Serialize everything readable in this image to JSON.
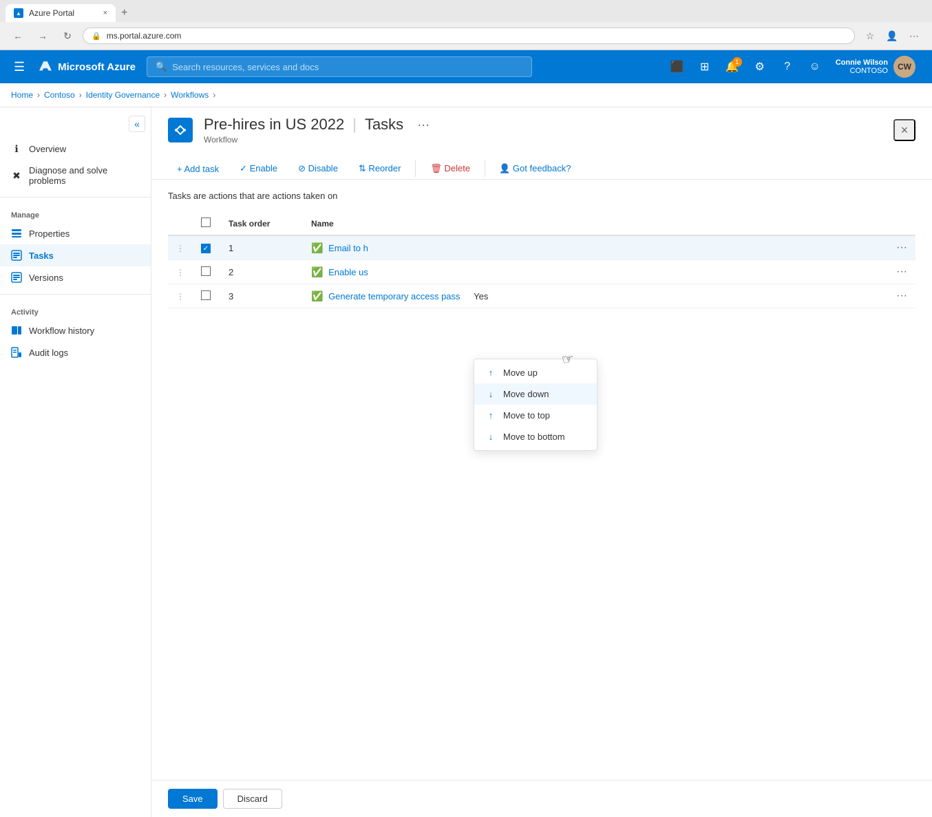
{
  "browser": {
    "tab_title": "Azure Portal",
    "tab_close": "×",
    "new_tab": "+",
    "nav_back": "←",
    "nav_forward": "→",
    "nav_refresh": "↻",
    "address": "ms.portal.azure.com",
    "address_icon": "🔒",
    "fav_icon": "☆",
    "profile_icon": "👤",
    "more_icon": "⋯"
  },
  "topbar": {
    "hamburger": "☰",
    "brand": "Microsoft Azure",
    "search_placeholder": "Search resources, services and docs",
    "user_name": "Connie Wilson",
    "user_org": "CONTOSO",
    "notification_count": "1"
  },
  "breadcrumb": {
    "items": [
      "Home",
      "Contoso",
      "Identity Governance",
      "Workflows"
    ],
    "separators": [
      ">",
      ">",
      ">"
    ]
  },
  "sidebar": {
    "collapse_icon": "«",
    "items": [
      {
        "id": "overview",
        "label": "Overview",
        "icon": "ℹ"
      },
      {
        "id": "diagnose",
        "label": "Diagnose and solve problems",
        "icon": "✖"
      }
    ],
    "manage_title": "Manage",
    "manage_items": [
      {
        "id": "properties",
        "label": "Properties",
        "icon": "▦"
      },
      {
        "id": "tasks",
        "label": "Tasks",
        "icon": "☐",
        "active": true
      },
      {
        "id": "versions",
        "label": "Versions",
        "icon": "☐"
      }
    ],
    "activity_title": "Activity",
    "activity_items": [
      {
        "id": "workflow-history",
        "label": "Workflow history",
        "icon": "▦"
      },
      {
        "id": "audit-logs",
        "label": "Audit logs",
        "icon": "▦"
      }
    ]
  },
  "page": {
    "workflow_icon": "⇄",
    "title": "Pre-hires in US 2022",
    "divider": "|",
    "subtitle": "Tasks",
    "more": "···",
    "workflow_label": "Workflow",
    "close": "×"
  },
  "toolbar": {
    "add_task": "+ Add task",
    "enable": "✓ Enable",
    "disable": "⊘ Disable",
    "reorder": "⇅ Reorder",
    "delete": "🗑 Delete",
    "feedback": "👤 Got feedback?"
  },
  "content": {
    "description": "Tasks are actions that are actions taken on"
  },
  "table": {
    "columns": [
      "",
      "Task order",
      "Name",
      ""
    ],
    "rows": [
      {
        "order": "1",
        "name": "Email to h",
        "status_icon": "✅",
        "selected": true,
        "row_num": 1
      },
      {
        "order": "2",
        "name": "Enable us",
        "status_icon": "✅",
        "selected": false,
        "row_num": 2
      },
      {
        "order": "3",
        "name": "Generate temporary access pass",
        "status_icon": "✅",
        "extra": "Yes",
        "selected": false,
        "row_num": 3
      }
    ]
  },
  "dropdown": {
    "items": [
      {
        "id": "move-up",
        "label": "Move up",
        "icon": "↑"
      },
      {
        "id": "move-down",
        "label": "Move down",
        "icon": "↓",
        "highlighted": true
      },
      {
        "id": "move-to-top",
        "label": "Move to top",
        "icon": "↑"
      },
      {
        "id": "move-to-bottom",
        "label": "Move to bottom",
        "icon": "↓"
      }
    ]
  },
  "footer": {
    "save": "Save",
    "discard": "Discard"
  }
}
